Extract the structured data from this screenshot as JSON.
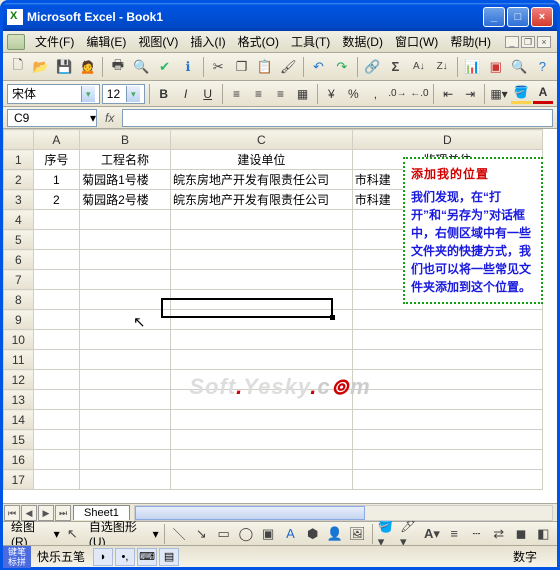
{
  "title": "Microsoft Excel - Book1",
  "menus": [
    "文件(F)",
    "编辑(E)",
    "视图(V)",
    "插入(I)",
    "格式(O)",
    "工具(T)",
    "数据(D)",
    "窗口(W)",
    "帮助(H)"
  ],
  "font": {
    "name": "宋体",
    "size": "12"
  },
  "namebox": "C9",
  "fx_label": "fx",
  "columns": [
    "A",
    "B",
    "C",
    "D"
  ],
  "headers": {
    "A": "序号",
    "B": "工程名称",
    "C": "建设单位",
    "D": "监理单位"
  },
  "rows": [
    {
      "A": "1",
      "B": "菊园路1号楼",
      "C": "皖东房地产开发有限责任公司",
      "D": "市科建"
    },
    {
      "A": "2",
      "B": "菊园路2号楼",
      "C": "皖东房地产开发有限责任公司",
      "D": "市科建"
    }
  ],
  "row_numbers": [
    1,
    2,
    3,
    4,
    5,
    6,
    7,
    8,
    9,
    10,
    11,
    12,
    13,
    14,
    15,
    16,
    17
  ],
  "sheet_tab": "Sheet1",
  "callout": {
    "title": "添加我的位置",
    "body": "我们发现，在“打开”和“另存为”对话框中，右侧区域中有一些文件夹的快捷方式，我们也可以将一些常见文件夹添加到这个位置。"
  },
  "draw": {
    "label": "绘图(R)",
    "autoshape": "自选图形(U)"
  },
  "status": {
    "ime": "快乐五笔",
    "right": "数字"
  },
  "watermark": {
    "a": "Soft",
    "b": "Yesky",
    "c": "c",
    "d": "m"
  },
  "chart_data": {
    "type": "table",
    "columns": [
      "序号",
      "工程名称",
      "建设单位",
      "监理单位"
    ],
    "rows": [
      [
        "1",
        "菊园路1号楼",
        "皖东房地产开发有限责任公司",
        "市科建…"
      ],
      [
        "2",
        "菊园路2号楼",
        "皖东房地产开发有限责任公司",
        "市科建…"
      ]
    ]
  }
}
